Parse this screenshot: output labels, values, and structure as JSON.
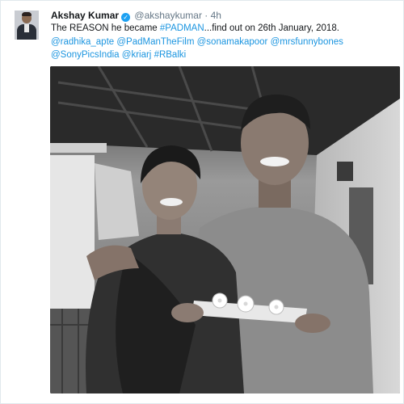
{
  "author": {
    "name": "Akshay Kumar",
    "handle": "@akshaykumar",
    "separator": "·",
    "time": "4h"
  },
  "tweet": {
    "line1_prefix": "The REASON he became ",
    "line1_hashtag": "#PADMAN",
    "line1_suffix": "...find out on 26th January, 2018.",
    "line2_mentions": [
      "@radhika_apte",
      "@PadManTheFilm",
      "@sonamakapoor",
      "@mrsfunnybones"
    ],
    "line3_mentions": [
      "@SonyPicsIndia",
      "@kriarj",
      "#RBalki"
    ]
  },
  "icons": {
    "verified": "verified-badge-icon",
    "verified_glyph": "✓"
  },
  "colors": {
    "link": "#1b95e0",
    "verified": "#1da1f2",
    "text": "#14171a",
    "muted": "#657786"
  }
}
